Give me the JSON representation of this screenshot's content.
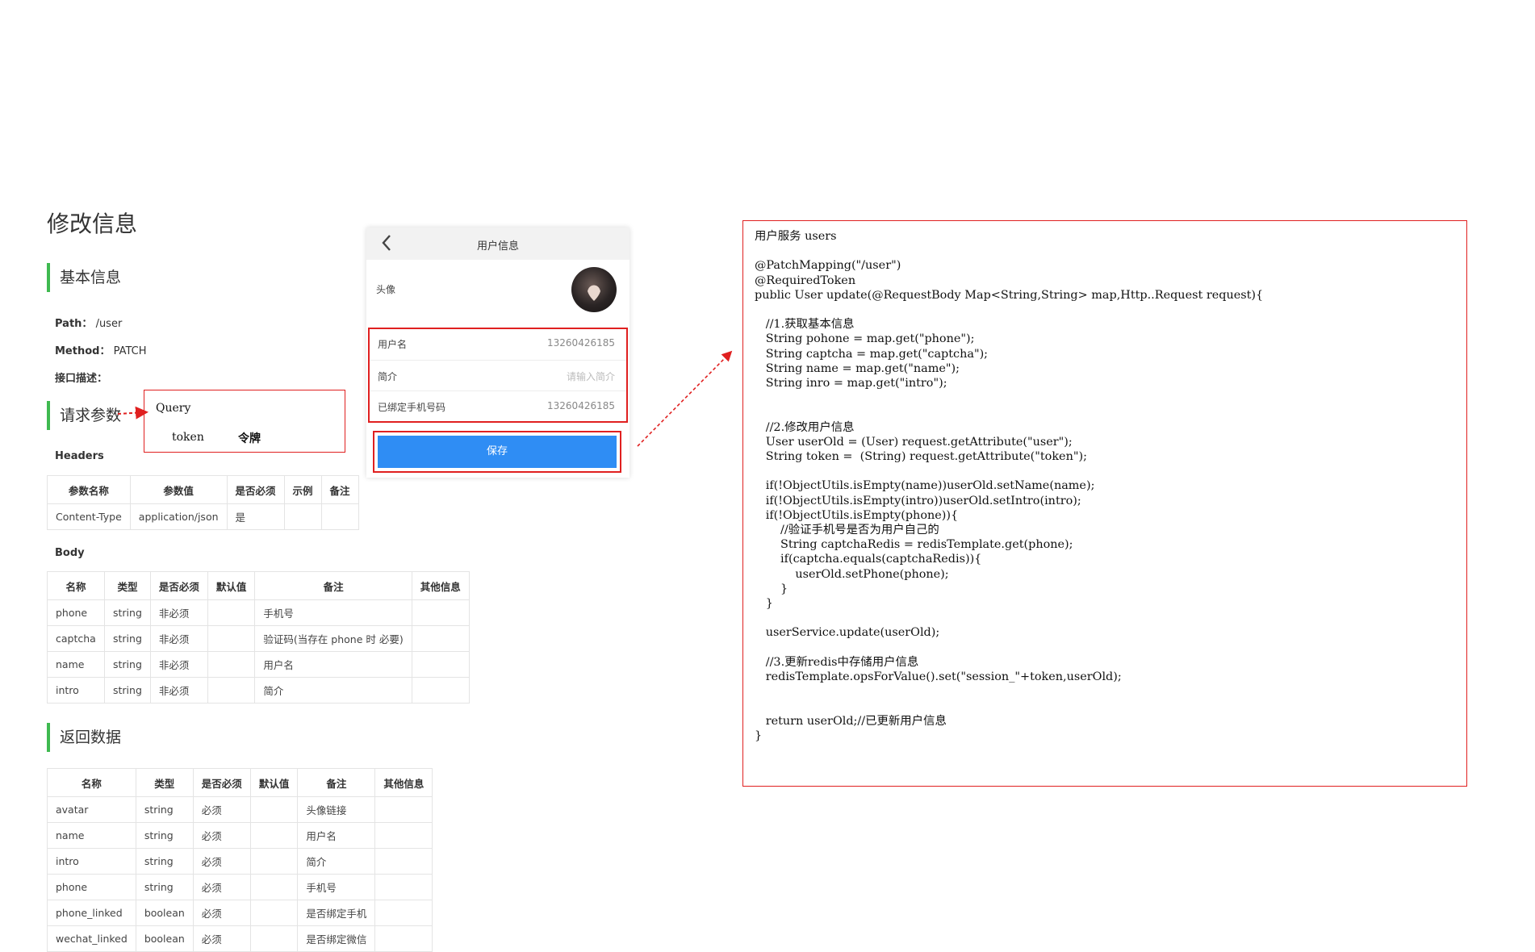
{
  "doc": {
    "title": "修改信息",
    "sections": {
      "basic": "基本信息",
      "request": "请求参数",
      "response": "返回数据"
    },
    "path_label": "Path：",
    "path_value": "/user",
    "method_label": "Method：",
    "method_value": "PATCH",
    "desc_label": "接口描述：",
    "headers_label": "Headers",
    "body_label": "Body",
    "headers_table": {
      "columns": [
        "参数名称",
        "参数值",
        "是否必须",
        "示例",
        "备注"
      ],
      "rows": [
        [
          "Content-Type",
          "application/json",
          "是",
          "",
          ""
        ]
      ]
    },
    "body_table": {
      "columns": [
        "名称",
        "类型",
        "是否必须",
        "默认值",
        "备注",
        "其他信息"
      ],
      "rows": [
        [
          "phone",
          "string",
          "非必须",
          "",
          "手机号",
          ""
        ],
        [
          "captcha",
          "string",
          "非必须",
          "",
          "验证码(当存在 phone 时 必要)",
          ""
        ],
        [
          "name",
          "string",
          "非必须",
          "",
          "用户名",
          ""
        ],
        [
          "intro",
          "string",
          "非必须",
          "",
          "简介",
          ""
        ]
      ]
    },
    "response_table": {
      "columns": [
        "名称",
        "类型",
        "是否必须",
        "默认值",
        "备注",
        "其他信息"
      ],
      "rows": [
        [
          "avatar",
          "string",
          "必须",
          "",
          "头像链接",
          ""
        ],
        [
          "name",
          "string",
          "必须",
          "",
          "用户名",
          ""
        ],
        [
          "intro",
          "string",
          "必须",
          "",
          "简介",
          ""
        ],
        [
          "phone",
          "string",
          "必须",
          "",
          "手机号",
          ""
        ],
        [
          "phone_linked",
          "boolean",
          "必须",
          "",
          "是否绑定手机",
          ""
        ],
        [
          "wechat_linked",
          "boolean",
          "必须",
          "",
          "是否绑定微信",
          ""
        ]
      ]
    }
  },
  "query_note": {
    "title": "Query",
    "param": "token",
    "meaning": "令牌"
  },
  "phone_ui": {
    "title": "用户信息",
    "back_icon": "chevron-left-icon",
    "avatar_label": "头像",
    "rows": [
      {
        "label": "用户名",
        "value": "13260426185"
      },
      {
        "label": "简介",
        "value": "请输入简介"
      },
      {
        "label": "已绑定手机号码",
        "value": "13260426185"
      }
    ],
    "save_button": "保存"
  },
  "code": {
    "text": "用户服务 users\n\n@PatchMapping(\"/user\")\n@RequiredToken\npublic User update(@RequestBody Map<String,String> map,Http..Request request){\n\n   //1.获取基本信息\n   String pohone = map.get(\"phone\");\n   String captcha = map.get(\"captcha\");\n   String name = map.get(\"name\");\n   String inro = map.get(\"intro\");\n\n\n   //2.修改用户信息\n   User userOld = (User) request.getAttribute(\"user\");\n   String token =  (String) request.getAttribute(\"token\");\n\n   if(!ObjectUtils.isEmpty(name))userOld.setName(name);\n   if(!ObjectUtils.isEmpty(intro))userOld.setIntro(intro);\n   if(!ObjectUtils.isEmpty(phone)){\n       //验证手机号是否为用户自己的\n       String captchaRedis = redisTemplate.get(phone);\n       if(captcha.equals(captchaRedis)){\n           userOld.setPhone(phone);\n       }\n   }\n\n   userService.update(userOld);\n\n   //3.更新redis中存储用户信息\n   redisTemplate.opsForValue().set(\"session_\"+token,userOld);\n\n\n   return userOld;//已更新用户信息\n}"
  },
  "colors": {
    "accent_green": "#3fb950",
    "annotation_red": "#e02020",
    "button_blue": "#2f8df4"
  }
}
